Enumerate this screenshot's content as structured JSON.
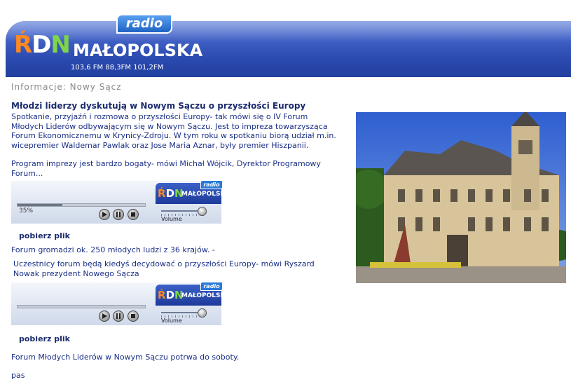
{
  "header": {
    "radio_label": "radio",
    "logo_letters": [
      "Ŕ",
      "D",
      "N"
    ],
    "station_name": "MAŁOPOLSKA",
    "frequencies": "103,6 FM  88,3FM  101,2FM",
    "colors": {
      "r": "#ff8a1f",
      "d": "#ffffff",
      "n": "#7fd44a",
      "banner": "#2a48ae"
    }
  },
  "section_title": "Informacje: Nowy Sącz",
  "article": {
    "title": "Młodzi liderzy dyskutują w Nowym Sączu o przyszłości Europy",
    "para1": [
      "Spotkanie, przyjaźń i rozmowa o przyszłości Europy- tak mówi się o IV Forum",
      "Młodych Liderów odbywającym się w Nowym Sączu. Jest to impreza towarzysząca",
      "Forum Ekonomicznemu w Krynicy-Zdroju. W tym roku w spotkaniu biorą udział m.in.",
      "wicepremier Waldemar Pawlak oraz Jose Maria Aznar, były premier Hiszpanii."
    ],
    "para2": [
      "Program imprezy jest bardzo bogaty- mówi Michał Wójcik, Dyrektor Programowy",
      "Forum..."
    ],
    "para3": "Forum gromadzi ok. 250 młodych ludzi z 36 krajów. -",
    "para4": [
      "Uczestnicy forum będą kiedyś decydować o przyszłości Europy- mówi Ryszard",
      "Nowak prezydent Nowego Sącza"
    ],
    "para5": "Forum Młodych Liderów w Nowym Sączu potrwa do soboty.",
    "author": "pas"
  },
  "players": [
    {
      "progress": 0.35,
      "progress_label": "35%",
      "volume_label": "Volume",
      "logo_tag": "radio",
      "logo_name": "MAŁOPOLSKA",
      "download_label": "pobierz plik"
    },
    {
      "progress": 0,
      "progress_label": "",
      "volume_label": "Volume",
      "logo_tag": "radio",
      "logo_name": "MAŁOPOLSKA",
      "download_label": "pobierz plik"
    }
  ]
}
